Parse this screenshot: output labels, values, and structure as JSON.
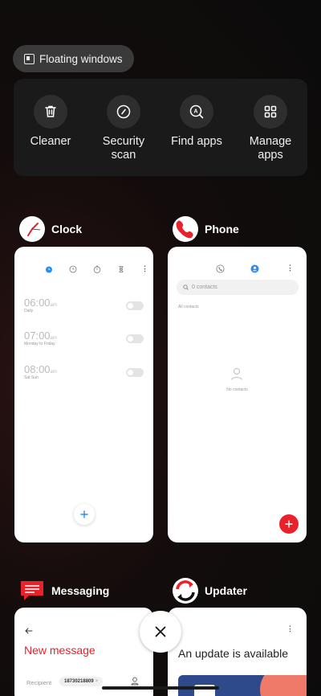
{
  "floating": {
    "label": "Floating windows"
  },
  "tools": [
    {
      "label": "Cleaner",
      "icon": "trash-icon"
    },
    {
      "label": "Security\nscan",
      "icon": "shield-check-icon"
    },
    {
      "label": "Find apps",
      "icon": "search-apps-icon"
    },
    {
      "label": "Manage\napps",
      "icon": "grid-icon"
    }
  ],
  "apps": {
    "clock": {
      "name": "Clock",
      "alarms": [
        {
          "time": "06:00",
          "ampm": "am",
          "repeat": "Daily"
        },
        {
          "time": "07:00",
          "ampm": "am",
          "repeat": "Monday to Friday"
        },
        {
          "time": "08:00",
          "ampm": "am",
          "repeat": "Sat Sun"
        }
      ]
    },
    "phone": {
      "name": "Phone",
      "search_placeholder": "0 contacts",
      "section": "All contacts",
      "empty": "No contacts"
    },
    "messaging": {
      "name": "Messaging",
      "title": "New message",
      "recipient_label": "Recipient",
      "recipient_value": "18730218809"
    },
    "updater": {
      "name": "Updater",
      "message": "An update is available"
    }
  },
  "colors": {
    "accent_blue": "#2d8cf0",
    "accent_red": "#e8212b"
  }
}
